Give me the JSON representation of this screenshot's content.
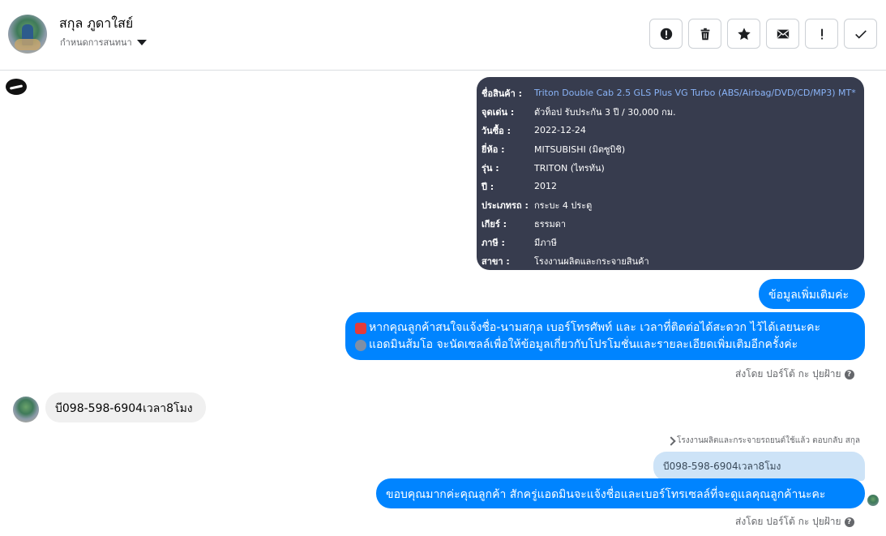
{
  "header": {
    "name": "สกุล ภูดาใสย์",
    "subtitle": "กำหนดการสนทนา",
    "actions": [
      {
        "icon": "alert-circle-icon",
        "name": "alert-button"
      },
      {
        "icon": "trash-icon",
        "name": "delete-button"
      },
      {
        "icon": "star-icon",
        "name": "star-button"
      },
      {
        "icon": "mail-icon",
        "name": "mark-unread-button"
      },
      {
        "icon": "exclamation-icon",
        "name": "spam-button"
      },
      {
        "icon": "check-icon",
        "name": "done-button"
      }
    ]
  },
  "product_card": {
    "rows": [
      {
        "label": "ชื่อสินค้า :",
        "value": "Triton Double Cab 2.5 GLS Plus VG Turbo (ABS/Airbag/DVD/CD/MP3) MT*"
      },
      {
        "label": "จุดเด่น :",
        "value": "ตัวท็อป รับประกัน 3 ปี / 30,000 กม."
      },
      {
        "label": "วันซื้อ :",
        "value": "2022-12-24"
      },
      {
        "label": "ยี่ห้อ :",
        "value": "MITSUBISHI (มิตซูบิชิ)"
      },
      {
        "label": "รุ่น :",
        "value": "TRITON (ไทรทัน)"
      },
      {
        "label": "ปี :",
        "value": "2012"
      },
      {
        "label": "ประเภทรถ :",
        "value": "กระบะ 4 ประตู"
      },
      {
        "label": "เกียร์ :",
        "value": "ธรรมดา"
      },
      {
        "label": "ภาษี :",
        "value": "มีภาษี"
      },
      {
        "label": "สาขา :",
        "value": "โรงงานผลิตและกระจายสินค้า"
      }
    ]
  },
  "messages": {
    "out_1": "ข้อมูลเพิ่มเติมค่ะ",
    "out_2_line_1": "หากคุณลูกค้าสนใจแจ้งชื่อ-นามสกุล เบอร์โทรศัพท์ และ เวลาที่ติดต่อได้สะดวก ไว้ได้เลยนะคะ",
    "out_2_line_2": "แอดมินส้มโอ จะนัดเซลล์เพื่อให้ข้อมูลเกี่ยวกับโปรโมชั่นและรายละเอียดเพิ่มเติมอีกครั้งค่ะ",
    "sent_by_1": "ส่งโดย ปอร์โต้ กะ ปุยฝ้าย",
    "in_1": "บี098-598-6904เวลา8โมง",
    "reply_note": "โรงงานผลิตและกระจายรถยนต์ใช้แล้ว ตอบกลับ สกุล",
    "quote": "บี098-598-6904เวลา8โมง",
    "out_3": "ขอบคุณมากค่ะคุณลูกค้า สักครู่แอดมินจะแจ้งชื่อและเบอร์โทรเซลล์ที่จะดูแลคุณลูกค้านะคะ",
    "sent_by_2": "ส่งโดย ปอร์โต้ กะ ปุยฝ้าย"
  },
  "colors": {
    "accent": "#0084ff",
    "card_bg": "#373c4e",
    "card_link": "#8ab4f8"
  }
}
